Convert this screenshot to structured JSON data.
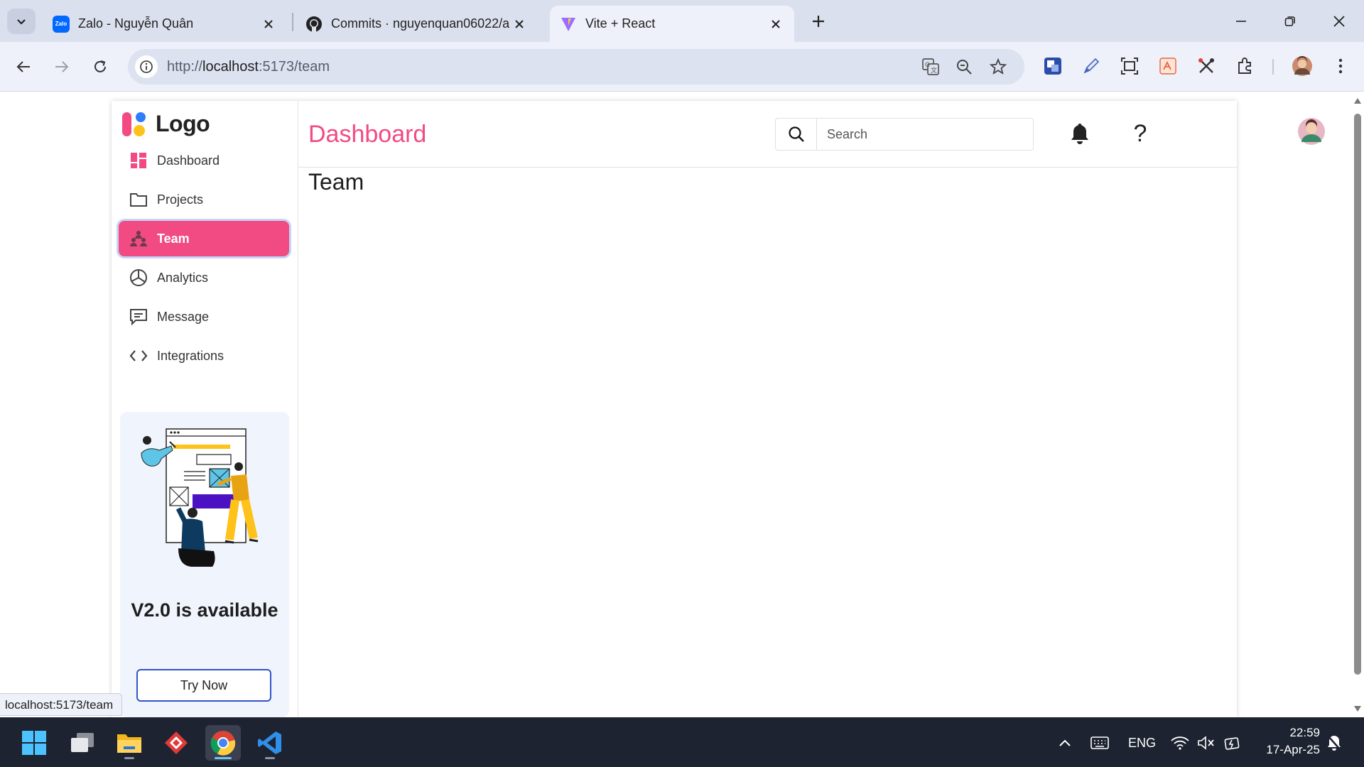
{
  "browser": {
    "tabs": [
      {
        "title": "Zalo - Nguyễn Quân",
        "favicon": "zalo-icon",
        "favicon_text": "Zalo"
      },
      {
        "title": "Commits · nguyenquan06022/a",
        "favicon": "github-icon"
      },
      {
        "title": "Vite + React",
        "favicon": "vite-icon"
      }
    ],
    "url_prefix": "http://",
    "url_host": "localhost",
    "url_rest": ":5173/team",
    "status_url": "localhost:5173/team"
  },
  "app": {
    "logo": "Logo",
    "page_title": "Dashboard",
    "search_placeholder": "Search",
    "help_label": "?",
    "main_heading": "Team",
    "nav": [
      {
        "label": "Dashboard",
        "icon": "dashboard-icon"
      },
      {
        "label": "Projects",
        "icon": "folder-icon"
      },
      {
        "label": "Team",
        "icon": "team-icon",
        "active": true
      },
      {
        "label": "Analytics",
        "icon": "pie-chart-icon"
      },
      {
        "label": "Message",
        "icon": "message-icon"
      },
      {
        "label": "Integrations",
        "icon": "code-icon"
      }
    ],
    "promo": {
      "headline": "V2.0 is available",
      "button": "Try Now"
    },
    "colors": {
      "accent": "#f24a83",
      "promo_bg": "#f0f5fd",
      "button_border": "#3253c7"
    }
  },
  "taskbar": {
    "language": "ENG",
    "time": "22:59",
    "date": "17-Apr-25"
  }
}
